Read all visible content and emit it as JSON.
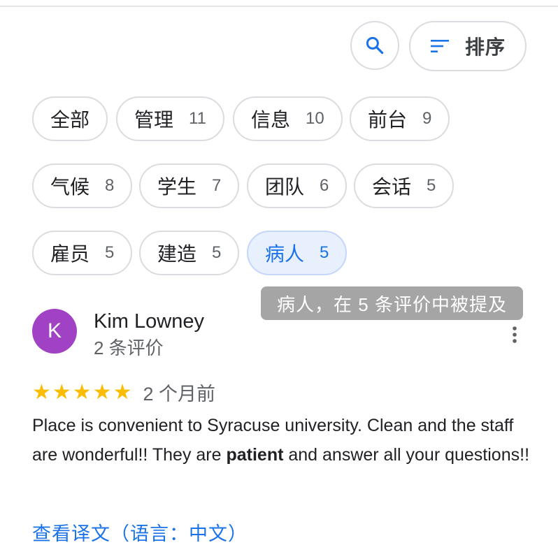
{
  "toolbar": {
    "search_icon": "search-icon",
    "sort_icon": "sort-icon",
    "sort_label": "排序",
    "accent_color": "#1a73e8"
  },
  "chips": [
    {
      "label": "全部",
      "count": ""
    },
    {
      "label": "管理",
      "count": "11"
    },
    {
      "label": "信息",
      "count": "10"
    },
    {
      "label": "前台",
      "count": "9"
    },
    {
      "label": "气候",
      "count": "8"
    },
    {
      "label": "学生",
      "count": "7"
    },
    {
      "label": "团队",
      "count": "6"
    },
    {
      "label": "会话",
      "count": "5"
    },
    {
      "label": "雇员",
      "count": "5"
    },
    {
      "label": "建造",
      "count": "5"
    },
    {
      "label": "病人",
      "count": "5",
      "active": true
    }
  ],
  "tooltip": "病人，在 5 条评价中被提及",
  "review": {
    "avatar_letter": "K",
    "avatar_color": "#a142c4",
    "author": "Kim Lowney",
    "review_count": "2 条评价",
    "stars": "★★★★★",
    "rating": 5,
    "time": "2 个月前",
    "text_before": "Place is convenient to Syracuse university. Clean and the staff are wonderful!! They are ",
    "text_highlight": "patient",
    "text_after": " and answer all your questions!!",
    "translate_link": "查看译文（语言：中文）"
  }
}
